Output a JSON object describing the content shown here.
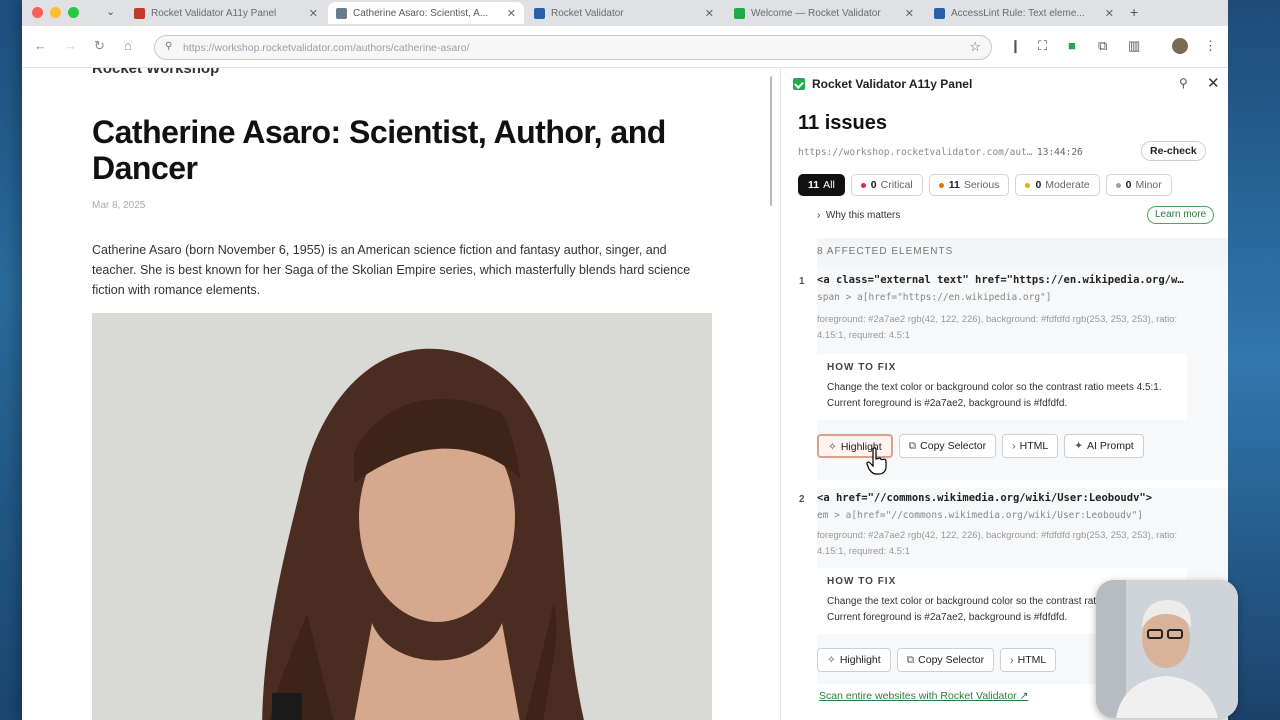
{
  "browser": {
    "tabs": [
      {
        "label": "Rocket Validator A11y Panel",
        "color": "#c0392b",
        "active": false
      },
      {
        "label": "Catherine Asaro: Scientist, A...",
        "color": "#6b7b8c",
        "active": true
      },
      {
        "label": "Rocket Validator",
        "color": "#2b5fa8",
        "active": false
      },
      {
        "label": "Welcome — Rocket Validator",
        "color": "#23a94a",
        "active": false
      },
      {
        "label": "AccessLint Rule: Text eleme...",
        "color": "#2b5fa8",
        "active": false
      }
    ],
    "url": "https://workshop.rocketvalidator.com/authors/catherine-asaro/"
  },
  "page": {
    "site_name": "Rocket Workshop",
    "title": "Catherine Asaro: Scientist, Author, and Dancer",
    "date": "Mar 8, 2025",
    "intro": "Catherine Asaro (born November 6, 1955) is an American science fiction and fantasy author, singer, and teacher. She is best known for her Saga of the Skolian Empire series, which masterfully blends hard science fiction with romance elements."
  },
  "panel": {
    "title": "Rocket Validator A11y Panel",
    "issues_count": "11 issues",
    "scan_url": "https://workshop.rocketvalidator.com/auth…",
    "scan_time": "13:44:26",
    "recheck_label": "Re-check",
    "filters": [
      {
        "count": "11",
        "label": "All",
        "active": true,
        "color": ""
      },
      {
        "count": "0",
        "label": "Critical",
        "active": false,
        "color": "#d93025"
      },
      {
        "count": "11",
        "label": "Serious",
        "active": false,
        "color": "#e8710a"
      },
      {
        "count": "0",
        "label": "Moderate",
        "active": false,
        "color": "#e0b400"
      },
      {
        "count": "0",
        "label": "Minor",
        "active": false,
        "color": "#9aa0a6"
      }
    ],
    "why_label": "Why this matters",
    "learn_more": "Learn more",
    "affected_header": "8 AFFECTED ELEMENTS",
    "elements": [
      {
        "num": "1",
        "code": "<a class=\"external text\" href=\"https://en.wikipedia.org/wiki/Catherine_Asaro\">",
        "selector": "span > a[href=\"https://en.wikipedia.org\"]",
        "meta": "foreground: #2a7ae2 rgb(42, 122, 226), background: #fdfdfd rgb(253, 253, 253), ratio: 4.15:1, required: 4.5:1",
        "fix_title": "HOW TO FIX",
        "fix_text": "Change the text color or background color so the contrast ratio meets 4.5:1. Current foreground is #2a7ae2, background is #fdfdfd."
      },
      {
        "num": "2",
        "code": "<a href=\"//commons.wikimedia.org/wiki/User:Leoboudv\">",
        "selector": "em > a[href=\"//commons.wikimedia.org/wiki/User:Leoboudv\"]",
        "meta": "foreground: #2a7ae2 rgb(42, 122, 226), background: #fdfdfd rgb(253, 253, 253), ratio: 4.15:1, required: 4.5:1",
        "fix_title": "HOW TO FIX",
        "fix_text": "Change the text color or background color so the contrast ratio meets 4.5:1. Current foreground is #2a7ae2, background is #fdfdfd."
      }
    ],
    "actions": {
      "highlight": "Highlight",
      "copy_selector": "Copy Selector",
      "html": "HTML",
      "ai_prompt": "AI Prompt"
    },
    "footer_link": "Scan entire websites with Rocket Validator ↗"
  },
  "colors": {
    "accent_green": "#23a94a",
    "link_green": "#2f7a3d"
  }
}
